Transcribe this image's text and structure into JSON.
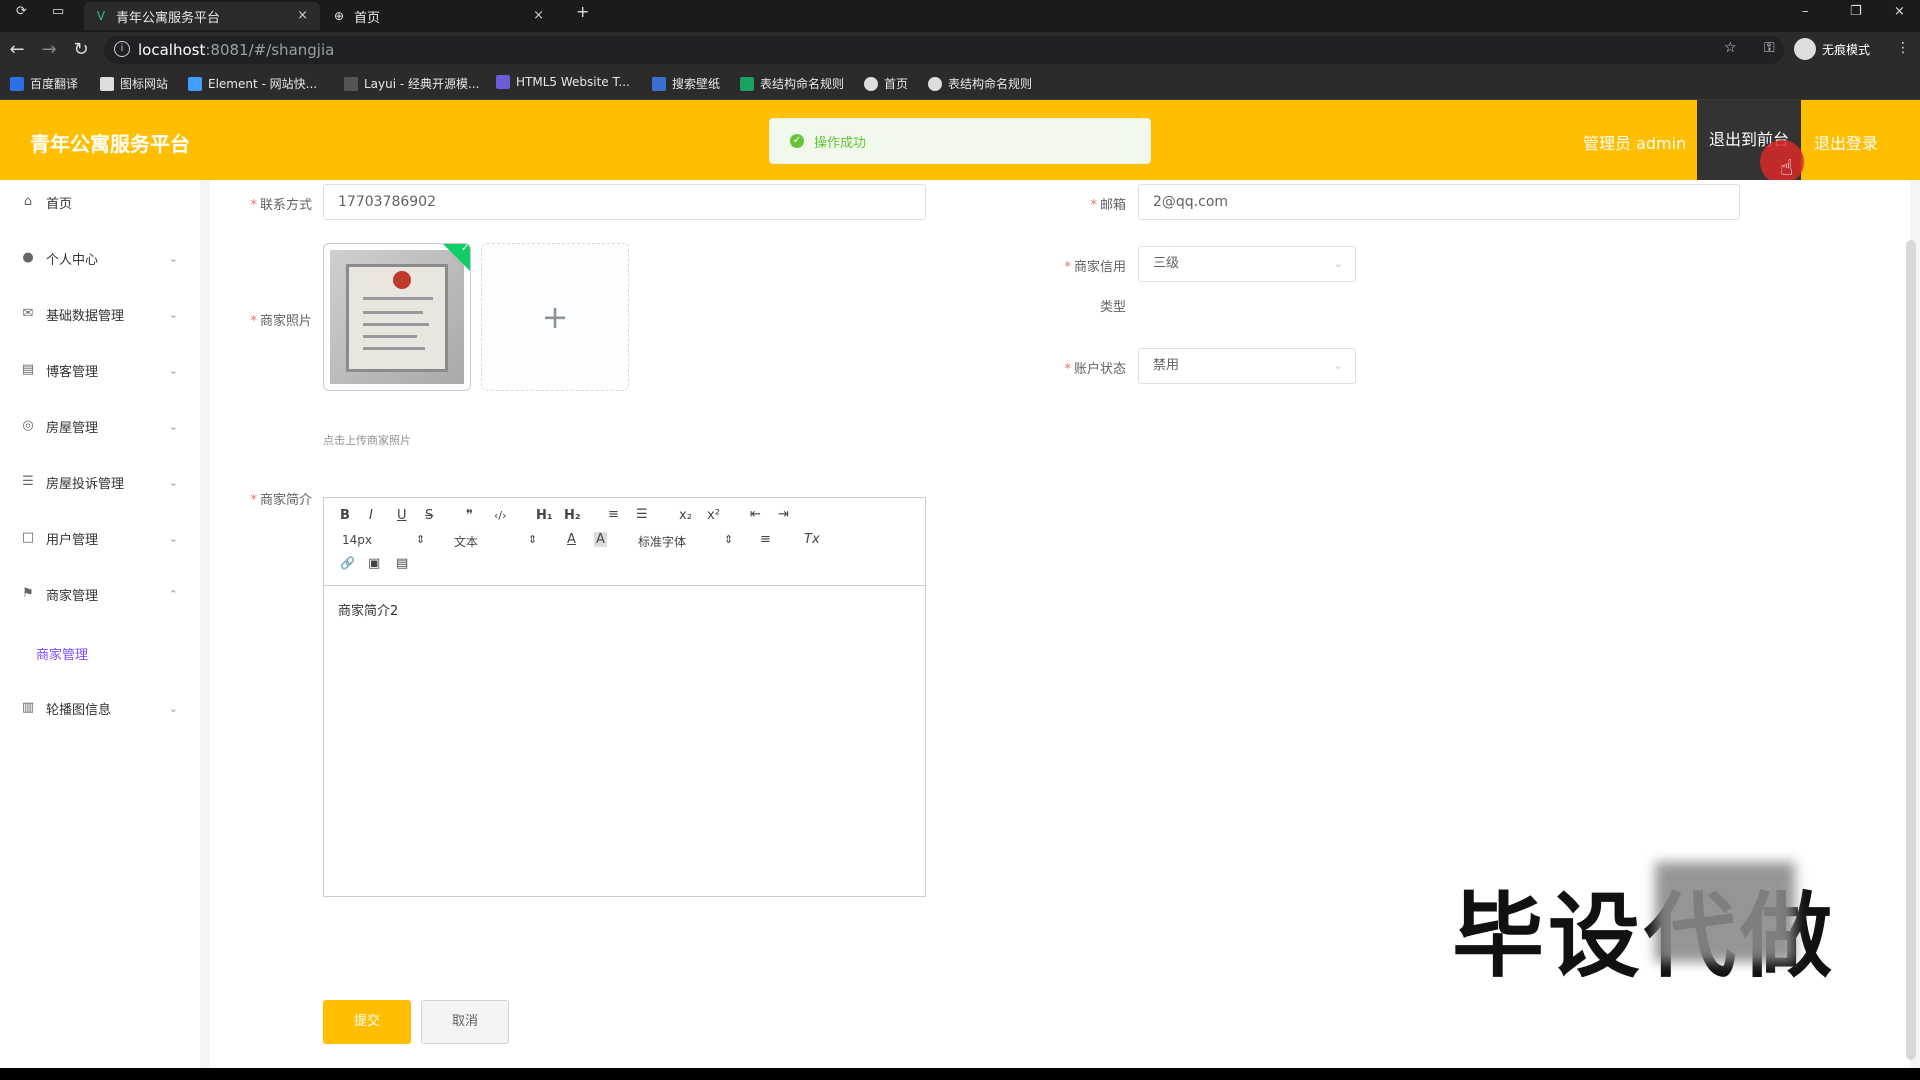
{
  "browser": {
    "tabs": [
      {
        "label": "青年公寓服务平台",
        "active": true
      },
      {
        "label": "首页",
        "active": false
      }
    ],
    "new_tab": "+",
    "url_host": "localhost",
    "url_path": ":8081/#/shangjia",
    "profile_label": "无痕模式",
    "bookmarks": [
      "百度翻译",
      "图标网站",
      "Element - 网站快...",
      "Layui - 经典开源模...",
      "HTML5 Website T...",
      "搜索壁纸",
      "表结构命名规则",
      "首页",
      "表结构命名规则"
    ]
  },
  "header": {
    "brand": "青年公寓服务平台",
    "toast": "操作成功",
    "admin": "管理员 admin",
    "front": "退出到前台",
    "logout": "退出登录"
  },
  "sidebar": {
    "items": [
      {
        "label": "首页",
        "icon": "home-icon",
        "expandable": false
      },
      {
        "label": "个人中心",
        "icon": "user-icon",
        "expandable": true
      },
      {
        "label": "基础数据管理",
        "icon": "mail-icon",
        "expandable": true
      },
      {
        "label": "博客管理",
        "icon": "clipboard-icon",
        "expandable": true
      },
      {
        "label": "房屋管理",
        "icon": "globe-icon",
        "expandable": true
      },
      {
        "label": "房屋投诉管理",
        "icon": "sliders-icon",
        "expandable": true
      },
      {
        "label": "用户管理",
        "icon": "square-icon",
        "expandable": true
      },
      {
        "label": "商家管理",
        "icon": "flag-icon",
        "expandable": true,
        "expanded": true
      },
      {
        "label": "轮播图信息",
        "icon": "chart-icon",
        "expandable": true
      }
    ],
    "submenu": "商家管理"
  },
  "form": {
    "contact_label": "联系方式",
    "contact_value": "17703786902",
    "email_label": "邮箱",
    "email_value": "2@qq.com",
    "photo_label": "商家照片",
    "photo_hint": "点击上传商家照片",
    "credit_label": "商家信用",
    "credit_label_2": "类型",
    "credit_value": "三级",
    "status_label": "账户状态",
    "status_value": "禁用",
    "intro_label": "商家简介",
    "intro_content": "商家简介2"
  },
  "editor_toolbar": {
    "bold": "B",
    "italic": "I",
    "underline": "U",
    "strike": "S",
    "quote": "❞",
    "code": "‹/›",
    "h1": "H₁",
    "h2": "H₂",
    "ol": "≡",
    "ul": "☰",
    "sub": "x₂",
    "sup": "x²",
    "outdent": "⇤",
    "indent": "⇥",
    "size": "14px",
    "text": "文本",
    "font": "标准字体",
    "color": "A",
    "bg": "A",
    "align": "≡",
    "clean": "Tx",
    "link": "🔗",
    "image": "▣",
    "video": "▤"
  },
  "buttons": {
    "submit": "提交",
    "cancel": "取消"
  },
  "watermark": "毕设代做"
}
